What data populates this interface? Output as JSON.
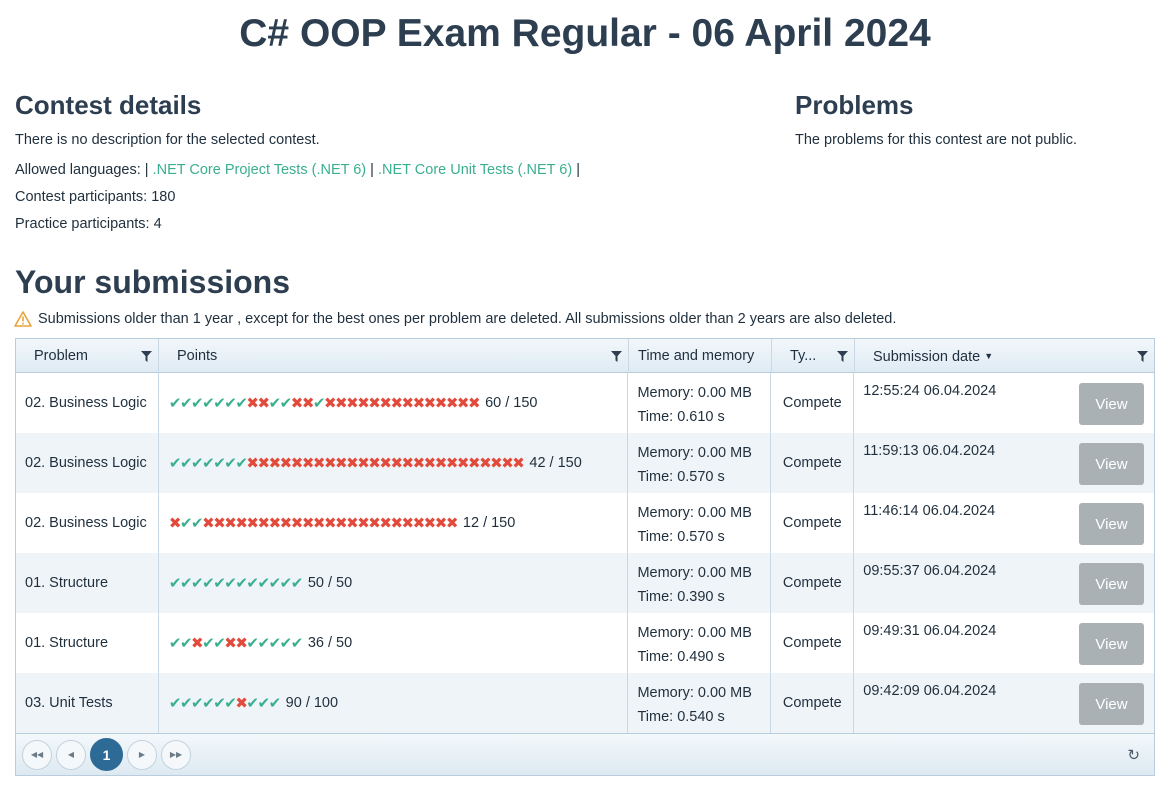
{
  "page_title": "C# OOP Exam Regular - 06 April 2024",
  "contest": {
    "heading": "Contest details",
    "description": "There is no description for the selected contest.",
    "languages_label": "Allowed languages: |",
    "languages": [
      ".NET Core Project Tests (.NET 6)",
      ".NET Core Unit Tests (.NET 6)"
    ],
    "separator": "|",
    "participants_label": "Contest participants: 180",
    "practice_label": "Practice participants: 4"
  },
  "problems": {
    "heading": "Problems",
    "text": "The problems for this contest are not public."
  },
  "submissions": {
    "heading": "Your submissions",
    "warning": "Submissions older than 1 year , except for the best ones per problem are deleted. All submissions older than 2 years are also deleted.",
    "columns": {
      "problem": "Problem",
      "points": "Points",
      "time_memory": "Time and memory",
      "type": "Ty...",
      "date": "Submission date",
      "sort_indicator": "▼"
    },
    "rows": [
      {
        "problem": "02. Business Logic",
        "tests": "ooooooo xx oo xx o xxxxxxxxxxxxxx",
        "points": "60 / 150",
        "memory": "Memory: 0.00 MB",
        "time": "Time: 0.610 s",
        "type": "Compete",
        "date": "12:55:24 06.04.2024",
        "action": "View"
      },
      {
        "problem": "02. Business Logic",
        "tests": "ooooooo xxxxxxxxxxxxxxxxxxxxxxxxx",
        "points": "42 / 150",
        "memory": "Memory: 0.00 MB",
        "time": "Time: 0.570 s",
        "type": "Compete",
        "date": "11:59:13 06.04.2024",
        "action": "View"
      },
      {
        "problem": "02. Business Logic",
        "tests": "x oo xxxxxxxxxxxxxxxxxxxxxxx",
        "points": "12 / 150",
        "memory": "Memory: 0.00 MB",
        "time": "Time: 0.570 s",
        "type": "Compete",
        "date": "11:46:14 06.04.2024",
        "action": "View"
      },
      {
        "problem": "01. Structure",
        "tests": "oooooooooooo",
        "points": "50 / 50",
        "memory": "Memory: 0.00 MB",
        "time": "Time: 0.390 s",
        "type": "Compete",
        "date": "09:55:37 06.04.2024",
        "action": "View"
      },
      {
        "problem": "01. Structure",
        "tests": "oo x oo xx ooooo",
        "points": "36 / 50",
        "memory": "Memory: 0.00 MB",
        "time": "Time: 0.490 s",
        "type": "Compete",
        "date": "09:49:31 06.04.2024",
        "action": "View"
      },
      {
        "problem": "03. Unit Tests",
        "tests": "oooooo x ooo",
        "points": "90 / 100",
        "memory": "Memory: 0.00 MB",
        "time": "Time: 0.540 s",
        "type": "Compete",
        "date": "09:42:09 06.04.2024",
        "action": "View"
      }
    ],
    "pager": {
      "first_icon": "first-page-icon",
      "prev_icon": "prev-page-icon",
      "current_page": "1",
      "next_icon": "next-page-icon",
      "last_icon": "last-page-icon",
      "refresh_icon": "refresh-icon"
    }
  },
  "colors": {
    "pass": "#3aaf8f",
    "fail": "#e24b3c",
    "heading": "#2d3e50",
    "pager_current": "#2e6a96"
  }
}
